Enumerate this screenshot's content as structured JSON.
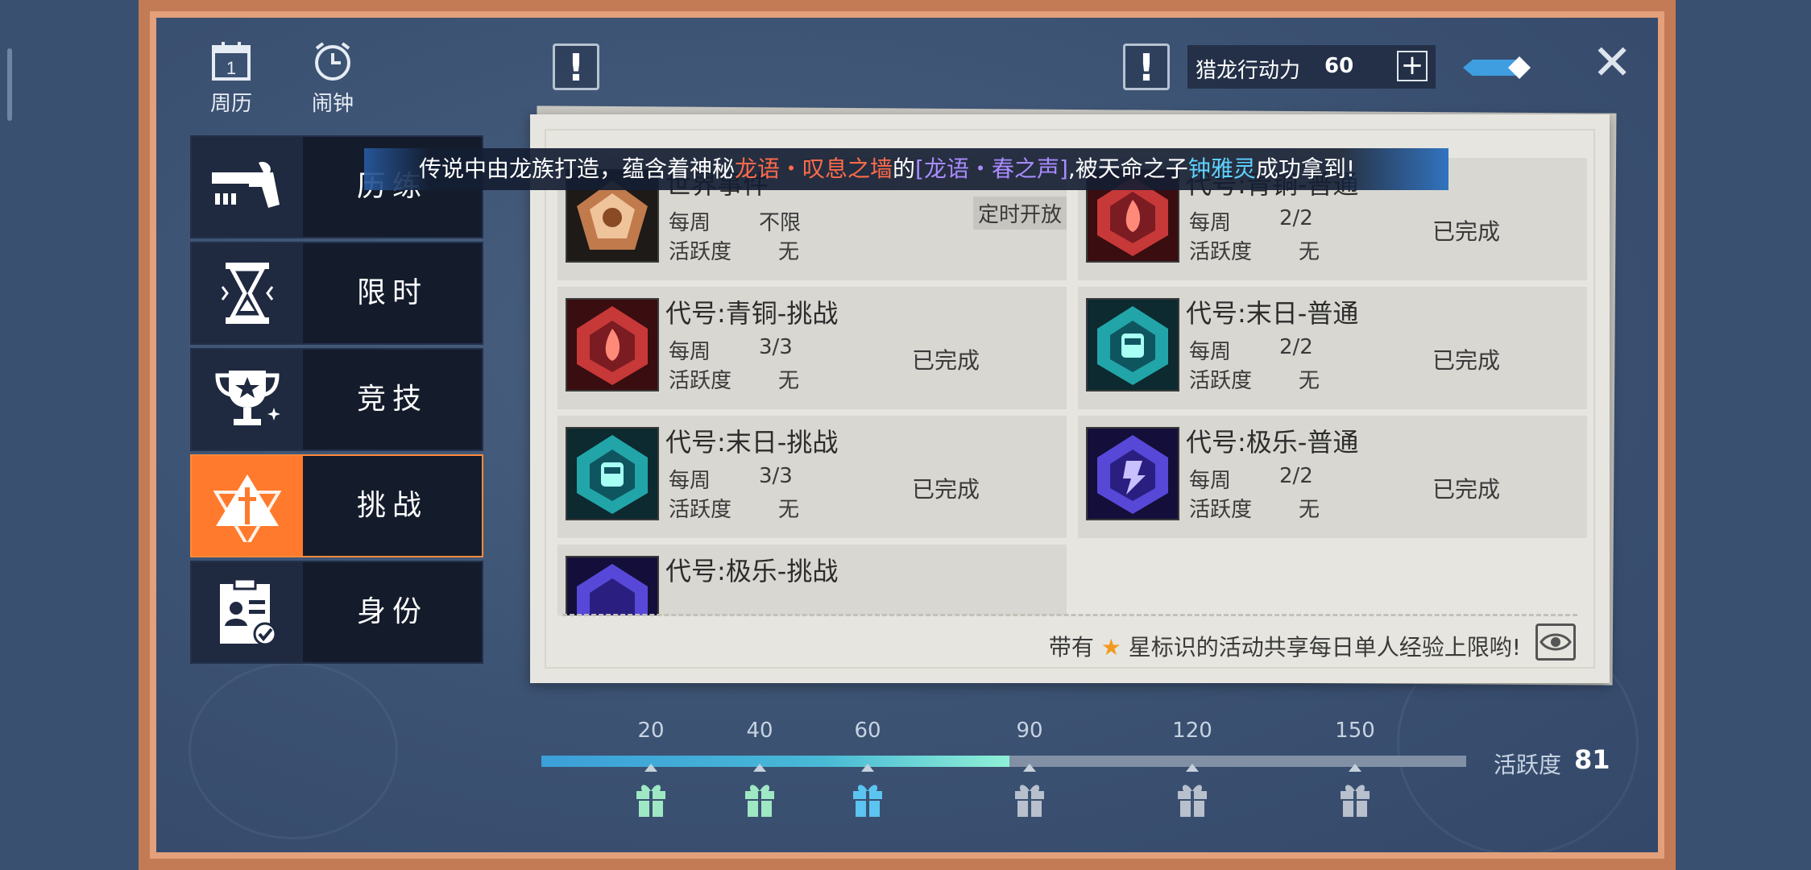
{
  "toolbar": {
    "calendar_label": "周历",
    "calendar_day": "1",
    "alarm_label": "闹钟",
    "alert_mark": "!",
    "stamina_label": "猎龙行动力",
    "stamina_value": "60",
    "plus_label": "+",
    "close_label": "✕"
  },
  "ticker": {
    "part1": "传说中由龙族打造，蕴含着神秘",
    "item1": "龙语・叹息之墙",
    "part2": "的",
    "item2": "[龙语・春之声]",
    "part3": ",被天命之子",
    "player": "钟雅灵",
    "part4": "成功拿到!"
  },
  "tabs": [
    {
      "label": "历练",
      "icon": "gun-icon",
      "active": false
    },
    {
      "label": "限时",
      "icon": "hourglass-icon",
      "active": false
    },
    {
      "label": "竞技",
      "icon": "trophy-icon",
      "active": false
    },
    {
      "label": "挑战",
      "icon": "sword-triangle-icon",
      "active": true
    },
    {
      "label": "身份",
      "icon": "id-clipboard-icon",
      "active": false
    }
  ],
  "activities": [
    {
      "name": "世界事件",
      "freq_label": "每周",
      "freq_value": "不限",
      "act_label": "活跃度",
      "act_value": "无",
      "status": "定时开放",
      "icon": "bronze-pentagon-emblem-icon",
      "theme": "#c07a4c"
    },
    {
      "name": "代号:青铜-普通",
      "freq_label": "每周",
      "freq_value": "2/2",
      "act_label": "活跃度",
      "act_value": "无",
      "status": "已完成",
      "icon": "red-flame-emblem-icon",
      "theme": "#c73838"
    },
    {
      "name": "代号:青铜-挑战",
      "freq_label": "每周",
      "freq_value": "3/3",
      "act_label": "活跃度",
      "act_value": "无",
      "status": "已完成",
      "icon": "red-flame-emblem-icon",
      "theme": "#c73838"
    },
    {
      "name": "代号:末日-普通",
      "freq_label": "每周",
      "freq_value": "2/2",
      "act_label": "活跃度",
      "act_value": "无",
      "status": "已完成",
      "icon": "teal-train-emblem-icon",
      "theme": "#22a5a8"
    },
    {
      "name": "代号:末日-挑战",
      "freq_label": "每周",
      "freq_value": "3/3",
      "act_label": "活跃度",
      "act_value": "无",
      "status": "已完成",
      "icon": "teal-train-emblem-icon",
      "theme": "#22a5a8"
    },
    {
      "name": "代号:极乐-普通",
      "freq_label": "每周",
      "freq_value": "2/2",
      "act_label": "活跃度",
      "act_value": "无",
      "status": "已完成",
      "icon": "purple-emblem-icon",
      "theme": "#5748d8"
    },
    {
      "name": "代号:极乐-挑战",
      "freq_label": "",
      "freq_value": "",
      "act_label": "",
      "act_value": "",
      "status": "",
      "icon": "purple-emblem-icon",
      "theme": "#5748d8"
    }
  ],
  "footnote": {
    "prefix": "带有",
    "suffix": "星标识的活动共享每日单人经验上限哟!",
    "star_icon": "star-icon",
    "eye_icon": "eye-icon"
  },
  "progress": {
    "current": 81,
    "max": 160,
    "milestones": [
      {
        "value": "20",
        "claimed": true
      },
      {
        "value": "40",
        "claimed": true
      },
      {
        "value": "60",
        "claimed": true
      },
      {
        "value": "90",
        "claimed": false
      },
      {
        "value": "120",
        "claimed": false
      },
      {
        "value": "150",
        "claimed": false
      }
    ],
    "label": "活跃度",
    "value_text": "81"
  },
  "colors": {
    "accent_orange": "#ff7a2c",
    "gift_claimed_green": "#9ee8c4",
    "gift_claimed_blue": "#5bc4f0",
    "gift_locked": "#b7c0cc"
  }
}
